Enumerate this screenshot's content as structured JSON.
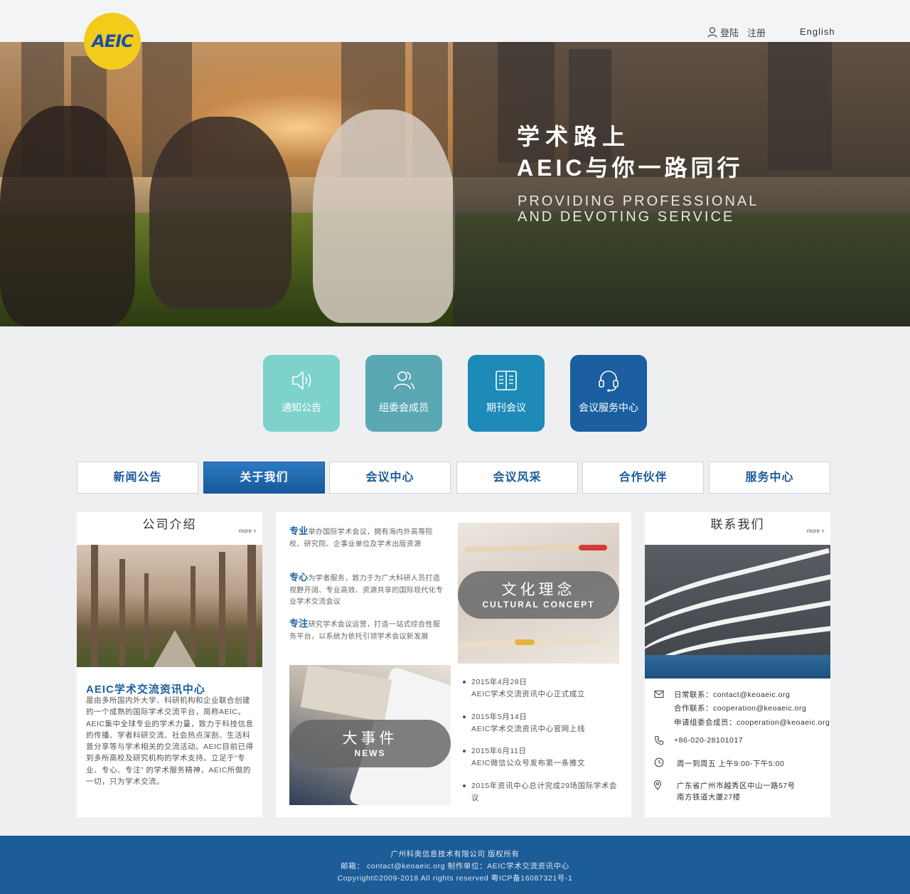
{
  "header": {
    "logo_text": "AEIC",
    "login": "登陆",
    "register": "注册",
    "language": "English"
  },
  "hero": {
    "title_line1": "学术路上",
    "title_line2": "AEIC与你一路同行",
    "subtitle_line1": "PROVIDING PROFESSIONAL",
    "subtitle_line2": "AND DEVOTING SERVICE"
  },
  "quick_links": [
    {
      "label": "通知公告",
      "icon": "speaker-icon",
      "color": "#7ed2cc"
    },
    {
      "label": "组委会成员",
      "icon": "users-icon",
      "color": "#5aa8b4"
    },
    {
      "label": "期刊会议",
      "icon": "book-icon",
      "color": "#1d8ab7"
    },
    {
      "label": "会议服务中心",
      "icon": "headset-icon",
      "color": "#1b5fa0"
    }
  ],
  "nav_tabs": [
    {
      "label": "新闻公告",
      "active": false
    },
    {
      "label": "关于我们",
      "active": true
    },
    {
      "label": "会议中心",
      "active": false
    },
    {
      "label": "会议风采",
      "active": false
    },
    {
      "label": "合作伙伴",
      "active": false
    },
    {
      "label": "服务中心",
      "active": false
    }
  ],
  "company": {
    "heading": "公司介绍",
    "more": "more +",
    "title": "AEIC学术交流资讯中心",
    "body": "是由多所国内外大学、科研机构和企业联合创建的一个成熟的国际学术交流平台，简称AEIC。AEIC集中全球专业的学术力量，致力于科技信息的传播、学者科研交流、社会热点深剖、生活科普分享等与学术相关的交流活动。AEIC目前已得到多所高校及研究机构的学术支持。立足于“专业、专心、专注” 的学术服务精神，AEIC所做的一切，只为学术交流。"
  },
  "about": {
    "items": [
      {
        "key": "专业",
        "text": "举办国际学术会议，拥有海内外高等院校、研究院、企事业单位及学术出版资源"
      },
      {
        "key": "专心",
        "text": "为学者服务，致力于为广大科研人员打造视野开阔、专业高效、资源共享的国际现代化专业学术交流会议"
      },
      {
        "key": "专注",
        "text": "研究学术会议运营，打造一站式综合性服务平台，以系统为依托引领学术会议新发展"
      }
    ],
    "culture_title": "文化理念",
    "culture_sub": "CULTURAL CONCEPT",
    "news_title": "大事件",
    "news_sub": "NEWS",
    "timeline": [
      {
        "date": "2015年4月28日",
        "text": "AEIC学术交流资讯中心正式成立"
      },
      {
        "date": "2015年5月14日",
        "text": "AEIC学术交流资讯中心官网上线"
      },
      {
        "date": "2015年6月11日",
        "text": "AEIC微信公众号发布第一条推文"
      },
      {
        "date": "",
        "text": "2015年资讯中心总计完成29场国际学术会议"
      }
    ]
  },
  "contact": {
    "heading": "联系我们",
    "more": "more +",
    "daily_label": "日常联系：",
    "daily_email": "contact@keoaeic.org",
    "coop_label": "合作联系：",
    "coop_email": "cooperation@keoaeic.org",
    "apply_label": "申请组委会成员：",
    "apply_email": "cooperation@keoaeic.org",
    "phone": "+86-020-28101017",
    "hours": "周一到周五 上午9:00-下午5:00",
    "address_line1": "广东省广州市越秀区中山一路57号",
    "address_line2": "南方铁道大厦27楼"
  },
  "footer": {
    "line1": "广州科奥信息技术有限公司 版权所有",
    "line2": "邮箱： contact@keoaeic.org 制作单位：AEIC学术交流资讯中心",
    "line3": "Copyright©2009-2018 All rights reserved 粤ICP备16087321号-1"
  }
}
